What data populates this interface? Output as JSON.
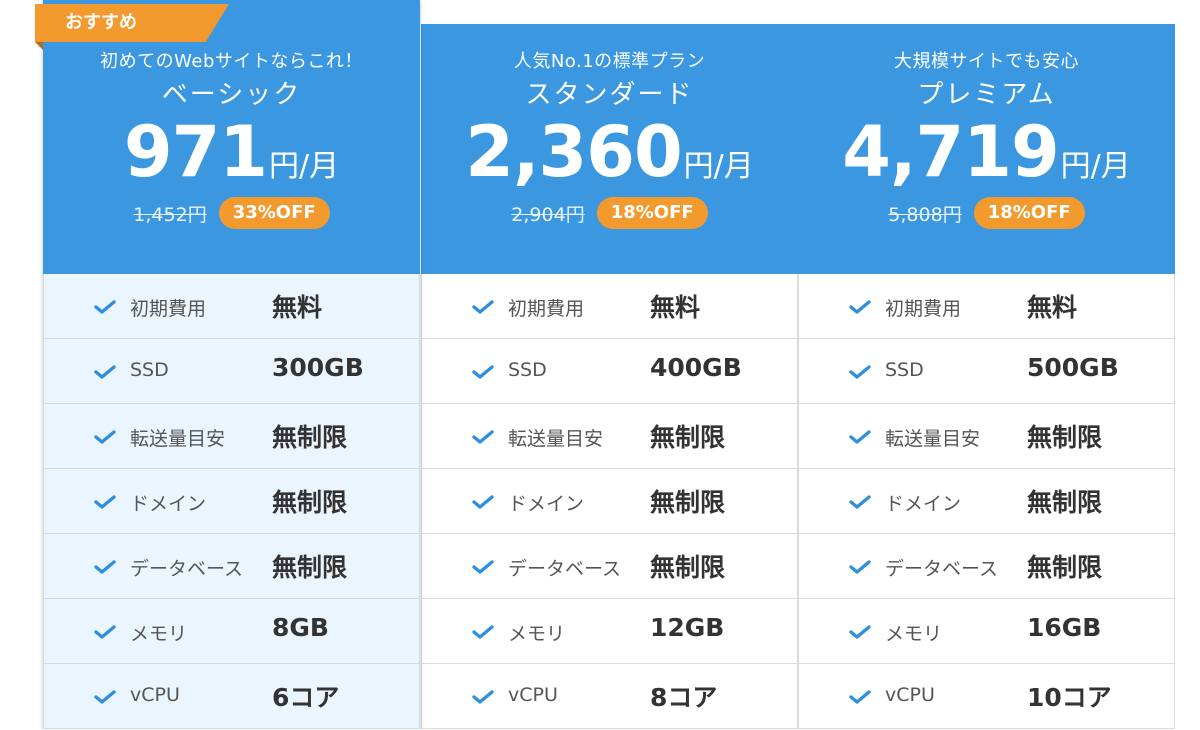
{
  "ribbon": "おすすめ",
  "plans": [
    {
      "tagline": "初めてのWebサイトならこれ！",
      "name": "ベーシック",
      "price": "971",
      "unit": "円/月",
      "original_price": "1,452円",
      "discount": "33%OFF",
      "features": [
        {
          "label": "初期費用",
          "value": "無料"
        },
        {
          "label": "SSD",
          "value": "300GB"
        },
        {
          "label": "転送量目安",
          "value": "無制限"
        },
        {
          "label": "ドメイン",
          "value": "無制限"
        },
        {
          "label": "データベース",
          "value": "無制限"
        },
        {
          "label": "メモリ",
          "value": "8GB"
        },
        {
          "label": "vCPU",
          "value": "6コア"
        }
      ]
    },
    {
      "tagline": "人気No.1の標準プラン",
      "name": "スタンダード",
      "price": "2,360",
      "unit": "円/月",
      "original_price": "2,904円",
      "discount": "18%OFF",
      "features": [
        {
          "label": "初期費用",
          "value": "無料"
        },
        {
          "label": "SSD",
          "value": "400GB"
        },
        {
          "label": "転送量目安",
          "value": "無制限"
        },
        {
          "label": "ドメイン",
          "value": "無制限"
        },
        {
          "label": "データベース",
          "value": "無制限"
        },
        {
          "label": "メモリ",
          "value": "12GB"
        },
        {
          "label": "vCPU",
          "value": "8コア"
        }
      ]
    },
    {
      "tagline": "大規模サイトでも安心",
      "name": "プレミアム",
      "price": "4,719",
      "unit": "円/月",
      "original_price": "5,808円",
      "discount": "18%OFF",
      "features": [
        {
          "label": "初期費用",
          "value": "無料"
        },
        {
          "label": "SSD",
          "value": "500GB"
        },
        {
          "label": "転送量目安",
          "value": "無制限"
        },
        {
          "label": "ドメイン",
          "value": "無制限"
        },
        {
          "label": "データベース",
          "value": "無制限"
        },
        {
          "label": "メモリ",
          "value": "16GB"
        },
        {
          "label": "vCPU",
          "value": "10コア"
        }
      ]
    }
  ],
  "colors": {
    "header_blue": "#3a97e0",
    "accent_orange": "#f39a2f",
    "check_blue": "#2f8fdc",
    "featured_bg": "#ebf5fd"
  },
  "icons": {
    "check": "check-icon"
  }
}
